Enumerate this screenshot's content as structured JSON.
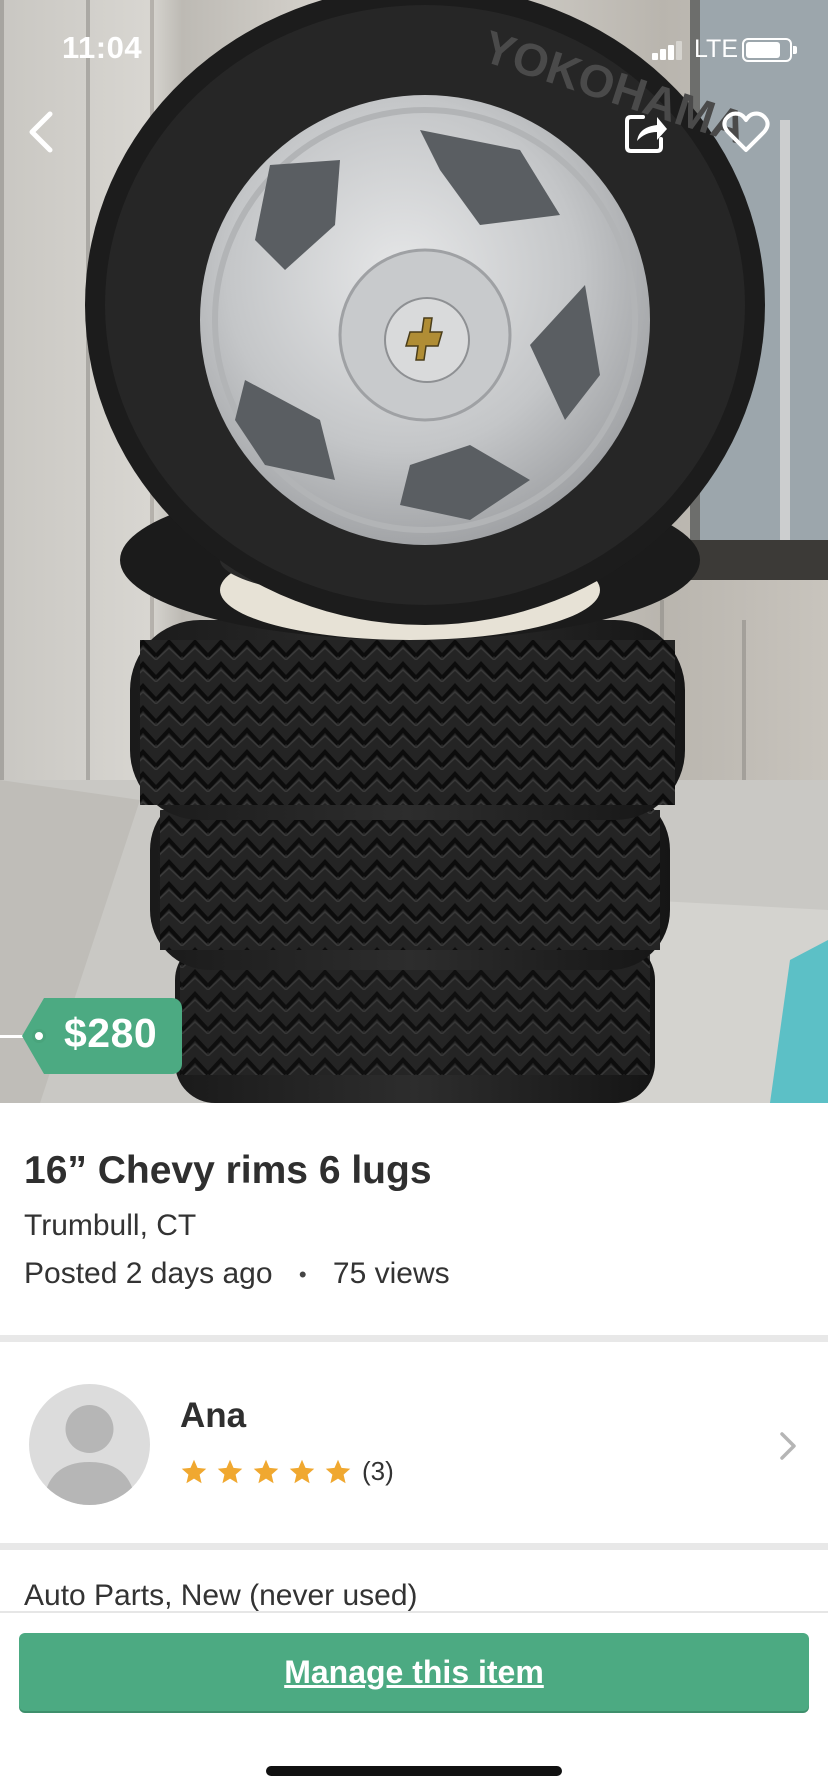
{
  "status_bar": {
    "time": "11:04",
    "network": "LTE"
  },
  "nav": {
    "back_icon": "chevron-left-icon",
    "share_icon": "share-icon",
    "favorite_icon": "heart-icon"
  },
  "photo": {
    "tire_brand_text": "YOKOHAMA"
  },
  "listing": {
    "price": "$280",
    "title": "16” Chevy rims 6 lugs",
    "location": "Trumbull, CT",
    "posted": "Posted 2 days ago",
    "separator": "•",
    "views": "75 views",
    "category": "Auto Parts, New (never used)"
  },
  "seller": {
    "name": "Ana",
    "rating": 5,
    "rating_count": "(3)"
  },
  "actions": {
    "manage_label": "Manage this item"
  },
  "colors": {
    "accent": "#4caa82",
    "star": "#f0a830",
    "divider": "#e8e8e8"
  }
}
